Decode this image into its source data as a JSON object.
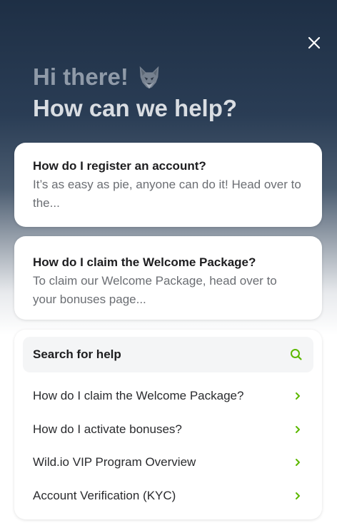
{
  "header": {
    "greeting": "Hi there!",
    "question": "How can we help?"
  },
  "icons": {
    "close": "close-icon",
    "mascot": "wolf-icon",
    "search": "search-icon",
    "chevron": "chevron-right-icon"
  },
  "colors": {
    "accent": "#5cb800",
    "greeting": "#8f9aa8",
    "question": "#d9dde2"
  },
  "articles": [
    {
      "title": "How do I register an account?",
      "snippet": "It’s as easy as pie, anyone can do it! Head over to the..."
    },
    {
      "title": "How do I claim the Welcome Package?",
      "snippet": "To claim our Welcome Package, head over to your bonuses page..."
    }
  ],
  "search": {
    "label": "Search for help",
    "items": [
      {
        "label": "How do I claim the Welcome Package?"
      },
      {
        "label": "How do I activate bonuses?"
      },
      {
        "label": "Wild.io VIP Program Overview"
      },
      {
        "label": "Account Verification (KYC)"
      }
    ]
  }
}
